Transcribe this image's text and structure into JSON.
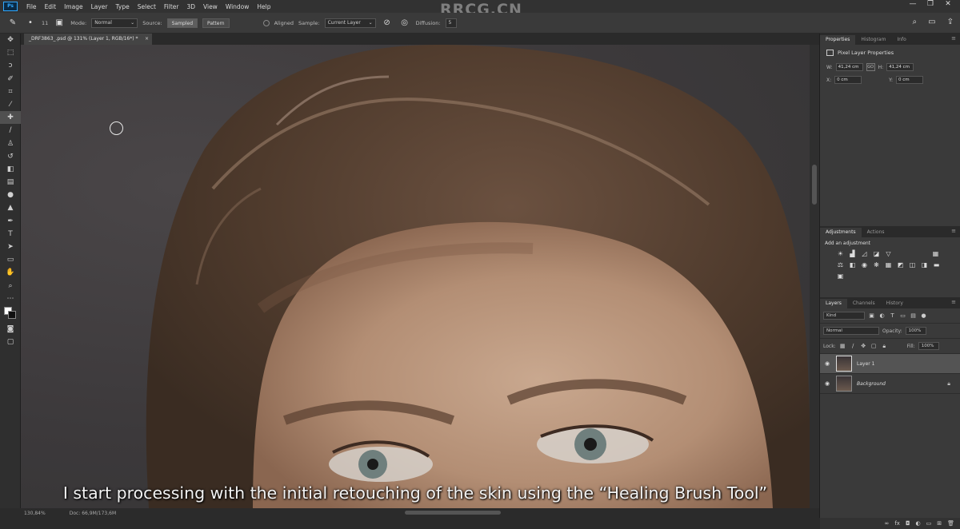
{
  "app": {
    "logo": "Ps",
    "watermark": "RRCG.CN"
  },
  "menu": [
    "File",
    "Edit",
    "Image",
    "Layer",
    "Type",
    "Select",
    "Filter",
    "3D",
    "View",
    "Window",
    "Help"
  ],
  "window_controls": [
    "—",
    "❐",
    "✕"
  ],
  "options": {
    "brush_size": "11",
    "mode_label": "Mode:",
    "mode_value": "Normal",
    "source_label": "Source:",
    "sampled": "Sampled",
    "pattern": "Pattern",
    "aligned": "Aligned",
    "sample_label": "Sample:",
    "sample_value": "Current Layer",
    "diffusion_label": "Diffusion:",
    "diffusion_value": "5"
  },
  "document": {
    "tab_title": "_DRF3863_.psd @ 131% (Layer 1, RGB/16*) *",
    "close": "×"
  },
  "caption": "I start processing with the initial retouching of the skin using the “Healing Brush Tool”",
  "status": {
    "zoom": "130,84%",
    "doc": "Doc: 66,9M/173,6M"
  },
  "properties": {
    "tabs": [
      "Properties",
      "Histogram",
      "Info"
    ],
    "header": "Pixel Layer Properties",
    "w_label": "W:",
    "w_value": "41,24 cm",
    "h_label": "H:",
    "h_value": "41,24 cm",
    "x_label": "X:",
    "x_value": "0 cm",
    "y_label": "Y:",
    "y_value": "0 cm",
    "link": "GO"
  },
  "adjustments": {
    "tabs": [
      "Adjustments",
      "Actions"
    ],
    "subtitle": "Add an adjustment"
  },
  "layers": {
    "tabs": [
      "Layers",
      "Channels",
      "History"
    ],
    "kind": "Kind",
    "blend": "Normal",
    "opacity_label": "Opacity:",
    "opacity_value": "100%",
    "lock_label": "Lock:",
    "fill_label": "Fill:",
    "fill_value": "100%",
    "items": [
      {
        "name": "Layer 1"
      },
      {
        "name": "Background"
      }
    ]
  }
}
